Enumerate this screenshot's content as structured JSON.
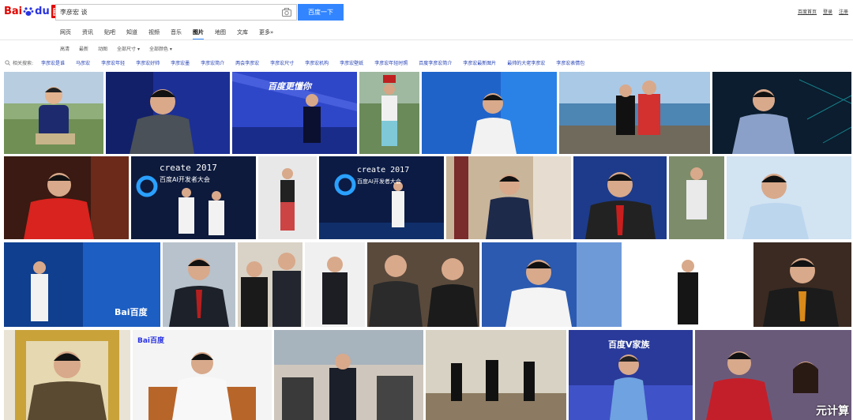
{
  "header": {
    "logo_bai": "Bai",
    "logo_du": "du",
    "logo_tu": "图片",
    "search_value": "李彦宏 谈",
    "search_button": "百度一下",
    "top_links": [
      "百度首页",
      "登录",
      "注册"
    ]
  },
  "tabs": [
    "网页",
    "资讯",
    "贴吧",
    "知道",
    "视频",
    "音乐",
    "图片",
    "地图",
    "文库",
    "更多»"
  ],
  "active_tab": "图片",
  "filters": [
    "高清",
    "最新",
    "动图",
    "全部尺寸 ▾",
    "全部颜色 ▾"
  ],
  "related": {
    "label": "相关搜索:",
    "keywords": [
      "李彦宏是谁",
      "马彦宏",
      "李彦宏年轻",
      "李彦宏好帅",
      "李彦宏墨",
      "李彦宏简介",
      "两会李彦宏",
      "李彦宏尺寸",
      "李彦宏机构",
      "李彦宏壁纸",
      "李彦宏年轻时照",
      "百度李彦宏简介",
      "李彦宏最新图片",
      "最帅的大佬李彦宏",
      "李彦宏表情包"
    ]
  },
  "thumb_texts": {
    "t3": "百度更懂你",
    "t10_1": "create 2017",
    "t10_2": "百度AI开发者大会",
    "t13_1": "create 2017",
    "t13_2": "百度AI开发者大会",
    "t22": "Bai百度",
    "t28": "Bai百度",
    "t36": "百度V家族"
  },
  "watermark": "元计算",
  "colors": {
    "accent": "#3385ff",
    "link": "#2440b3",
    "logo_red": "#e10601",
    "logo_blue": "#2932e1"
  }
}
